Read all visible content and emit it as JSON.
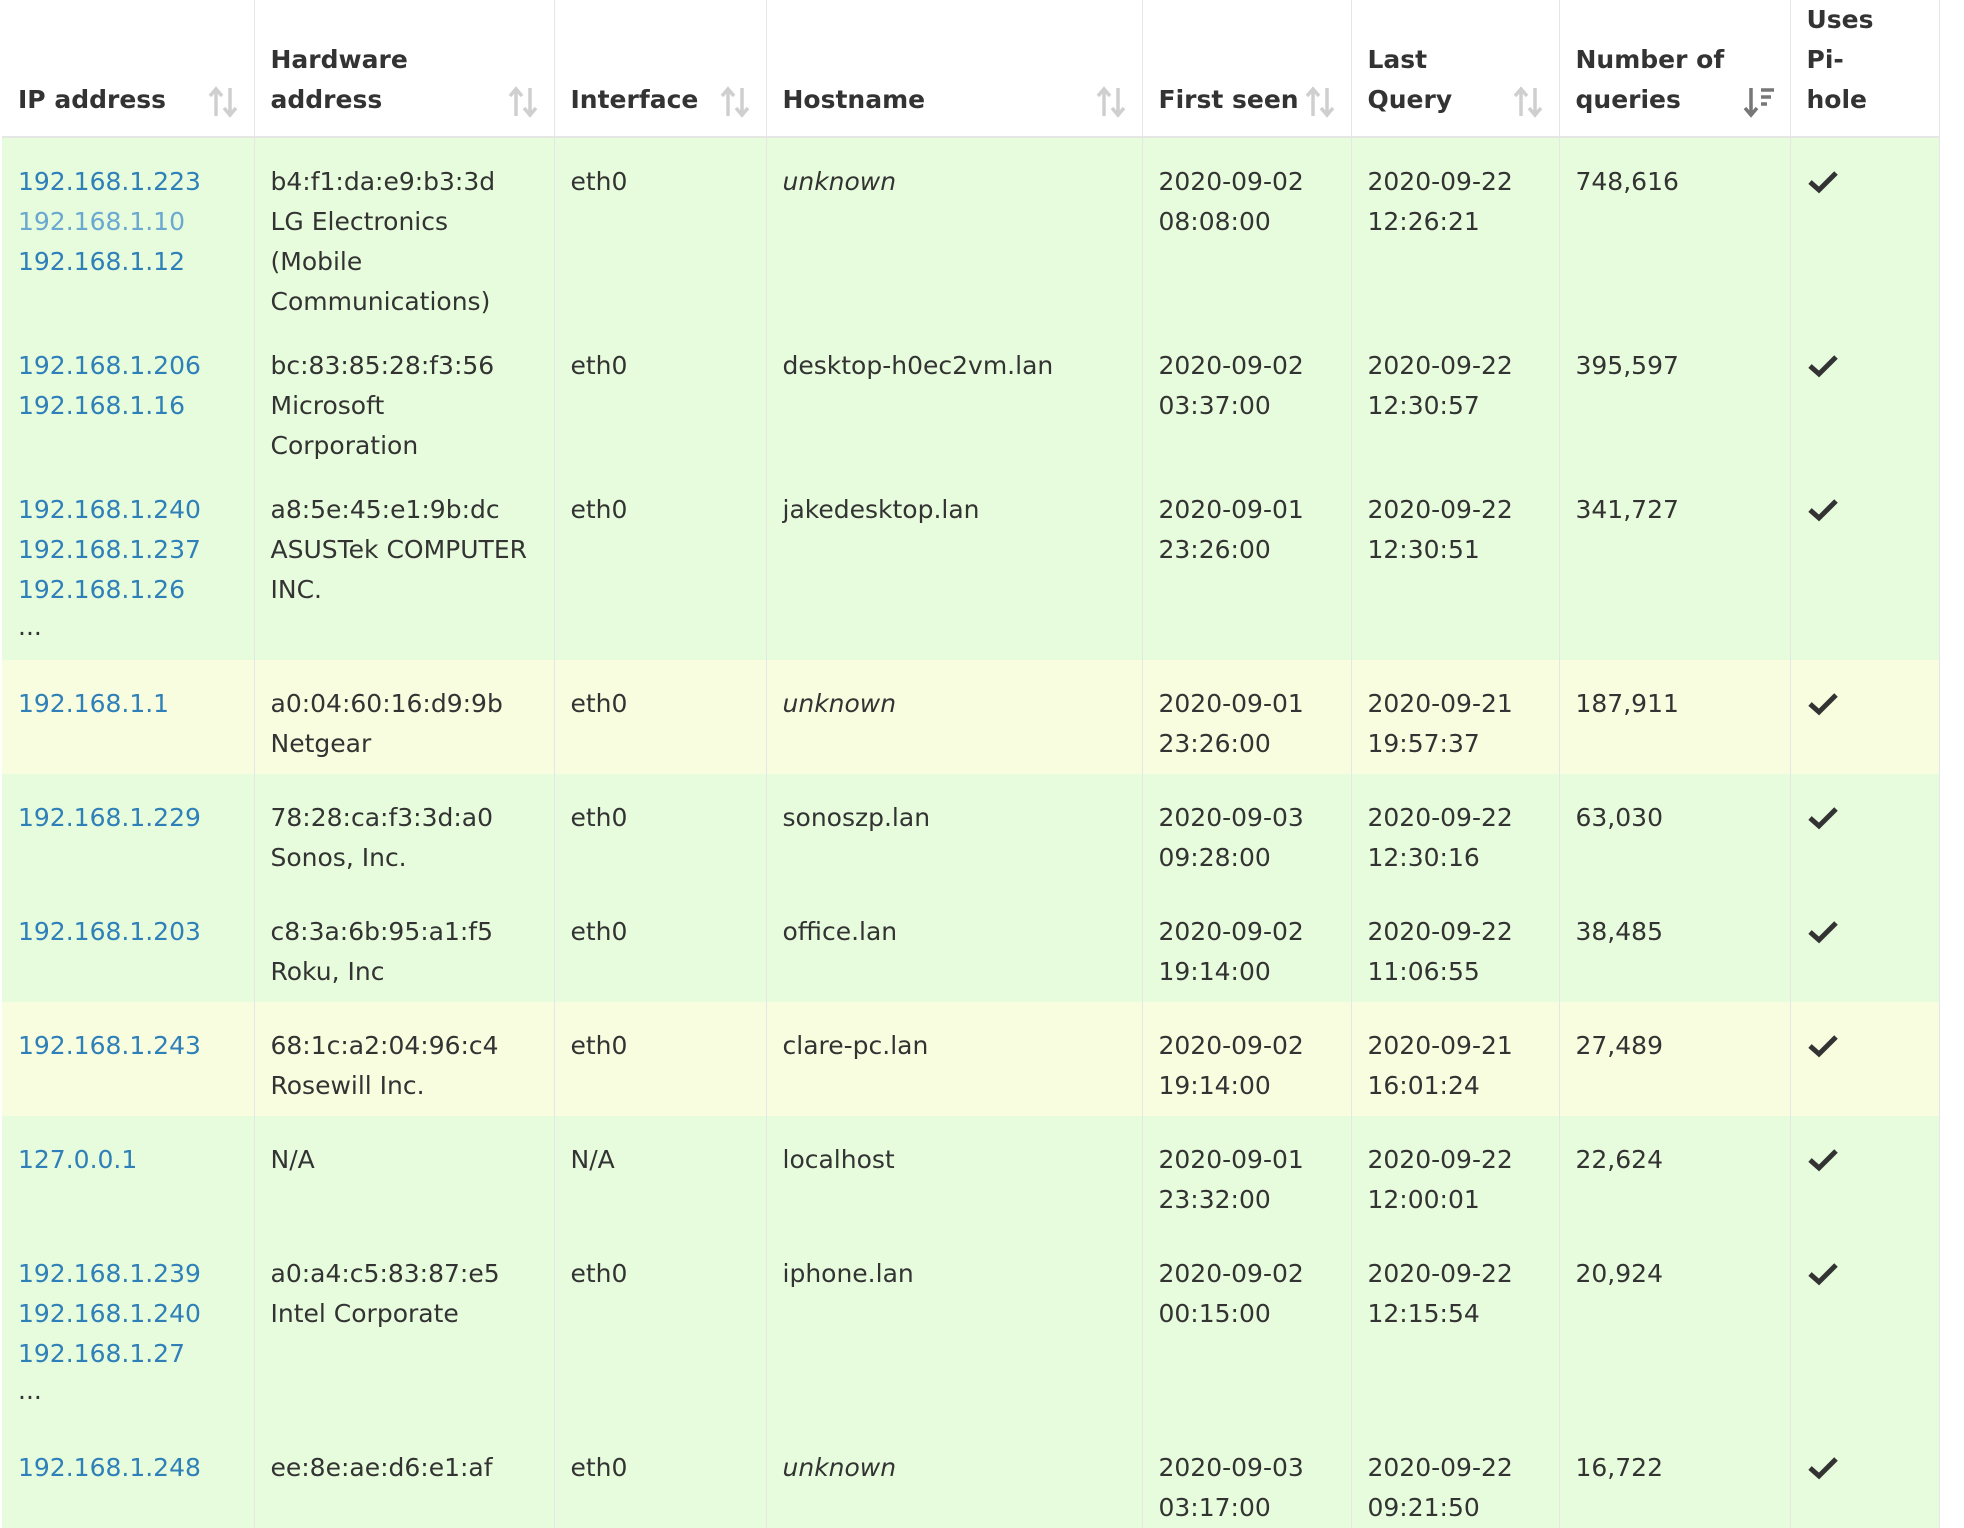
{
  "headers": [
    {
      "key": "ip",
      "label": "IP address",
      "sort": "sort-icon"
    },
    {
      "key": "hw",
      "label": "Hardware address",
      "sort": "sort-icon"
    },
    {
      "key": "iface",
      "label": "Interface",
      "sort": "sort-icon"
    },
    {
      "key": "host",
      "label": "Hostname",
      "sort": "sort-icon"
    },
    {
      "key": "first",
      "label": "First seen",
      "sort": "sort-icon"
    },
    {
      "key": "last",
      "label": "Last Query",
      "sort": "sort-icon"
    },
    {
      "key": "count",
      "label": "Number of queries",
      "sort": "sort-desc-icon"
    },
    {
      "key": "uses",
      "label": "Uses Pi-hole",
      "sort": ""
    }
  ],
  "colors": {
    "row_green": "#e7fcdc",
    "row_yellow": "#f8fddf",
    "link": "#2f80b9"
  },
  "rows": [
    {
      "tint": "green",
      "ips": [
        "192.168.1.223",
        "192.168.1.10",
        "192.168.1.12"
      ],
      "more": "",
      "mac": "b4:f1:da:e9:b3:3d",
      "vendor": "LG Electronics (Mobile Communications)",
      "iface": "eth0",
      "host": "unknown",
      "first_date": "2020-09-02",
      "first_time": "08:08:00",
      "last_date": "2020-09-22",
      "last_time": "12:26:21",
      "count": "748,616",
      "uses": "check-icon"
    },
    {
      "tint": "green",
      "ips": [
        "192.168.1.206",
        "192.168.1.16"
      ],
      "more": "",
      "mac": "bc:83:85:28:f3:56",
      "vendor": "Microsoft Corporation",
      "iface": "eth0",
      "host": "desktop-h0ec2vm.lan",
      "first_date": "2020-09-02",
      "first_time": "03:37:00",
      "last_date": "2020-09-22",
      "last_time": "12:30:57",
      "count": "395,597",
      "uses": "check-icon"
    },
    {
      "tint": "green",
      "ips": [
        "192.168.1.240",
        "192.168.1.237",
        "192.168.1.26"
      ],
      "more": "...",
      "mac": "a8:5e:45:e1:9b:dc",
      "vendor": "ASUSTek COMPUTER INC.",
      "iface": "eth0",
      "host": "jakedesktop.lan",
      "first_date": "2020-09-01",
      "first_time": "23:26:00",
      "last_date": "2020-09-22",
      "last_time": "12:30:51",
      "count": "341,727",
      "uses": "check-icon"
    },
    {
      "tint": "yellow",
      "ips": [
        "192.168.1.1"
      ],
      "more": "",
      "mac": "a0:04:60:16:d9:9b",
      "vendor": "Netgear",
      "iface": "eth0",
      "host": "unknown",
      "first_date": "2020-09-01",
      "first_time": "23:26:00",
      "last_date": "2020-09-21",
      "last_time": "19:57:37",
      "count": "187,911",
      "uses": "check-icon"
    },
    {
      "tint": "green",
      "ips": [
        "192.168.1.229"
      ],
      "more": "",
      "mac": "78:28:ca:f3:3d:a0",
      "vendor": "Sonos, Inc.",
      "iface": "eth0",
      "host": "sonoszp.lan",
      "first_date": "2020-09-03",
      "first_time": "09:28:00",
      "last_date": "2020-09-22",
      "last_time": "12:30:16",
      "count": "63,030",
      "uses": "check-icon"
    },
    {
      "tint": "green",
      "ips": [
        "192.168.1.203"
      ],
      "more": "",
      "mac": "c8:3a:6b:95:a1:f5",
      "vendor": "Roku, Inc",
      "iface": "eth0",
      "host": "office.lan",
      "first_date": "2020-09-02",
      "first_time": "19:14:00",
      "last_date": "2020-09-22",
      "last_time": "11:06:55",
      "count": "38,485",
      "uses": "check-icon"
    },
    {
      "tint": "yellow",
      "ips": [
        "192.168.1.243"
      ],
      "more": "",
      "mac": "68:1c:a2:04:96:c4",
      "vendor": "Rosewill Inc.",
      "iface": "eth0",
      "host": "clare-pc.lan",
      "first_date": "2020-09-02",
      "first_time": "19:14:00",
      "last_date": "2020-09-21",
      "last_time": "16:01:24",
      "count": "27,489",
      "uses": "check-icon"
    },
    {
      "tint": "green",
      "ips": [
        "127.0.0.1"
      ],
      "more": "",
      "mac": "N/A",
      "vendor": "",
      "iface": "N/A",
      "host": "localhost",
      "first_date": "2020-09-01",
      "first_time": "23:32:00",
      "last_date": "2020-09-22",
      "last_time": "12:00:01",
      "count": "22,624",
      "uses": "check-icon"
    },
    {
      "tint": "green",
      "ips": [
        "192.168.1.239",
        "192.168.1.240",
        "192.168.1.27"
      ],
      "more": "...",
      "mac": "a0:a4:c5:83:87:e5",
      "vendor": "Intel Corporate",
      "iface": "eth0",
      "host": "iphone.lan",
      "first_date": "2020-09-02",
      "first_time": "00:15:00",
      "last_date": "2020-09-22",
      "last_time": "12:15:54",
      "count": "20,924",
      "uses": "check-icon"
    },
    {
      "tint": "green",
      "ips": [
        "192.168.1.248"
      ],
      "more": "",
      "mac": "ee:8e:ae:d6:e1:af",
      "vendor": "",
      "iface": "eth0",
      "host": "unknown",
      "first_date": "2020-09-03",
      "first_time": "03:17:00",
      "last_date": "2020-09-22",
      "last_time": "09:21:50",
      "count": "16,722",
      "uses": "check-icon"
    }
  ]
}
